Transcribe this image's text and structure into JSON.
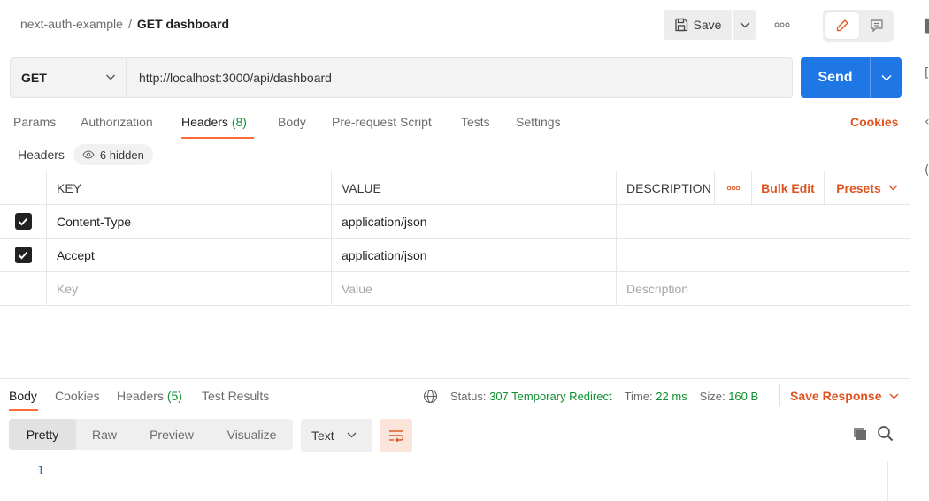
{
  "header": {
    "collection": "next-auth-example",
    "separator": "/",
    "request_name": "GET dashboard",
    "save_label": "Save",
    "more_label": "ooo"
  },
  "request": {
    "method": "GET",
    "url": "http://localhost:3000/api/dashboard",
    "send_label": "Send"
  },
  "request_tabs": [
    {
      "label": "Params"
    },
    {
      "label": "Authorization"
    },
    {
      "label": "Headers",
      "count": "(8)"
    },
    {
      "label": "Body"
    },
    {
      "label": "Pre-request Script"
    },
    {
      "label": "Tests"
    },
    {
      "label": "Settings"
    }
  ],
  "cookies_link": "Cookies",
  "headers_section": {
    "label": "Headers",
    "hidden_label": "6 hidden"
  },
  "headers_table": {
    "columns": {
      "key": "KEY",
      "value": "VALUE",
      "description": "DESCRIPTION"
    },
    "more_label": "ooo",
    "bulk_edit": "Bulk Edit",
    "presets": "Presets",
    "rows": [
      {
        "checked": true,
        "key": "Content-Type",
        "value": "application/json"
      },
      {
        "checked": true,
        "key": "Accept",
        "value": "application/json"
      }
    ],
    "placeholders": {
      "key": "Key",
      "value": "Value",
      "description": "Description"
    }
  },
  "response": {
    "tabs": [
      {
        "label": "Body"
      },
      {
        "label": "Cookies"
      },
      {
        "label": "Headers",
        "count": "(5)"
      },
      {
        "label": "Test Results"
      }
    ],
    "status_label": "Status:",
    "status_value": "307 Temporary Redirect",
    "time_label": "Time:",
    "time_value": "22 ms",
    "size_label": "Size:",
    "size_value": "160 B",
    "save_response": "Save Response",
    "view_modes": [
      "Pretty",
      "Raw",
      "Preview",
      "Visualize"
    ],
    "format": "Text",
    "line_number": "1"
  },
  "colors": {
    "accent": "#ff6c37",
    "link": "#e0531f",
    "send": "#1f77e6",
    "status_green": "#0f8f2f"
  }
}
